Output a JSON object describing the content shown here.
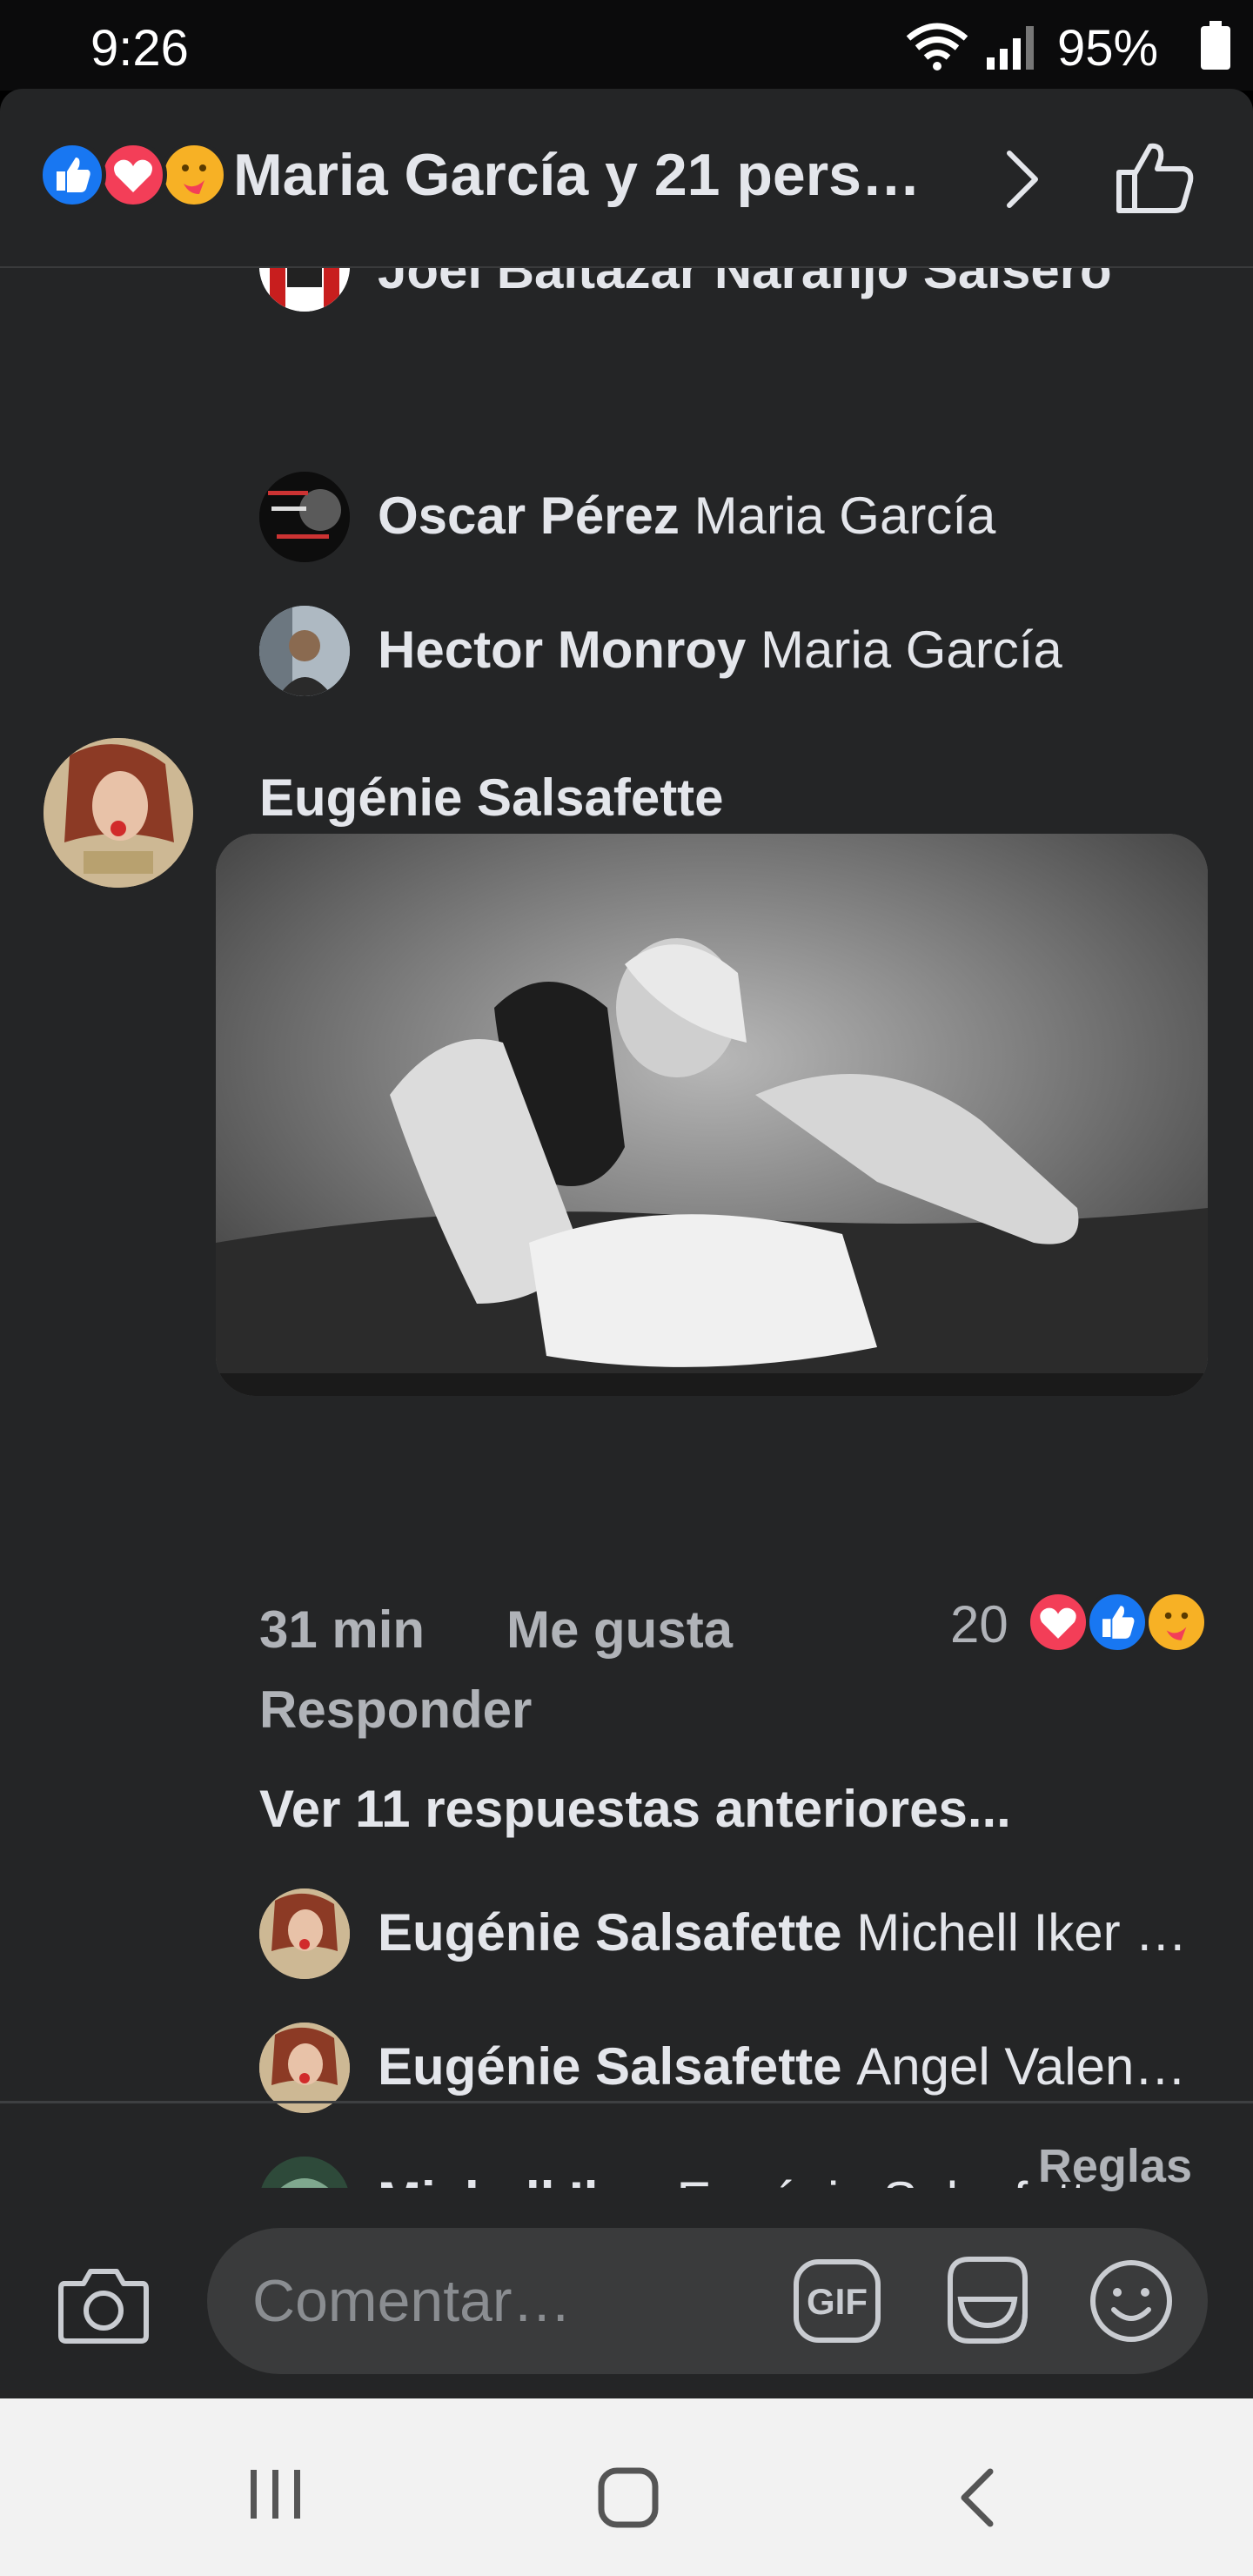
{
  "status_bar": {
    "time": "9:26",
    "battery": "95%"
  },
  "header": {
    "reactions": [
      "like-icon",
      "love-icon",
      "care-icon"
    ],
    "title": "Maria García y 21 pers…"
  },
  "replies_top": [
    {
      "name": "Joel Baltazar Naranjo Salsero",
      "text": ""
    },
    {
      "name": "Oscar Pérez",
      "text": "Maria García"
    },
    {
      "name": "Hector Monroy",
      "text": "Maria García"
    }
  ],
  "comment": {
    "author": "Eugénie Salsafette",
    "emoji": "🥰",
    "time": "31 min",
    "like_label": "Me gusta",
    "reply_label": "Responder",
    "reaction_count": "20",
    "reactions": [
      "love-icon",
      "like-icon",
      "care-icon"
    ]
  },
  "more_replies": "Ver 11 respuestas anteriores...",
  "replies_bottom": [
    {
      "name": "Eugénie Salsafette",
      "text": "Michell Iker …"
    },
    {
      "name": "Eugénie Salsafette",
      "text": "Angel Valen…"
    },
    {
      "name": "Michell Iker",
      "text": "Eugénie Salsafette"
    }
  ],
  "footer": {
    "rules": "Reglas",
    "placeholder": "Comentar…",
    "gif": "GIF"
  },
  "colors": {
    "sheet_bg": "#242526",
    "input_bg": "#3a3b3c",
    "like": "#1877f2",
    "love": "#f33e58",
    "care": "#f7b125"
  }
}
